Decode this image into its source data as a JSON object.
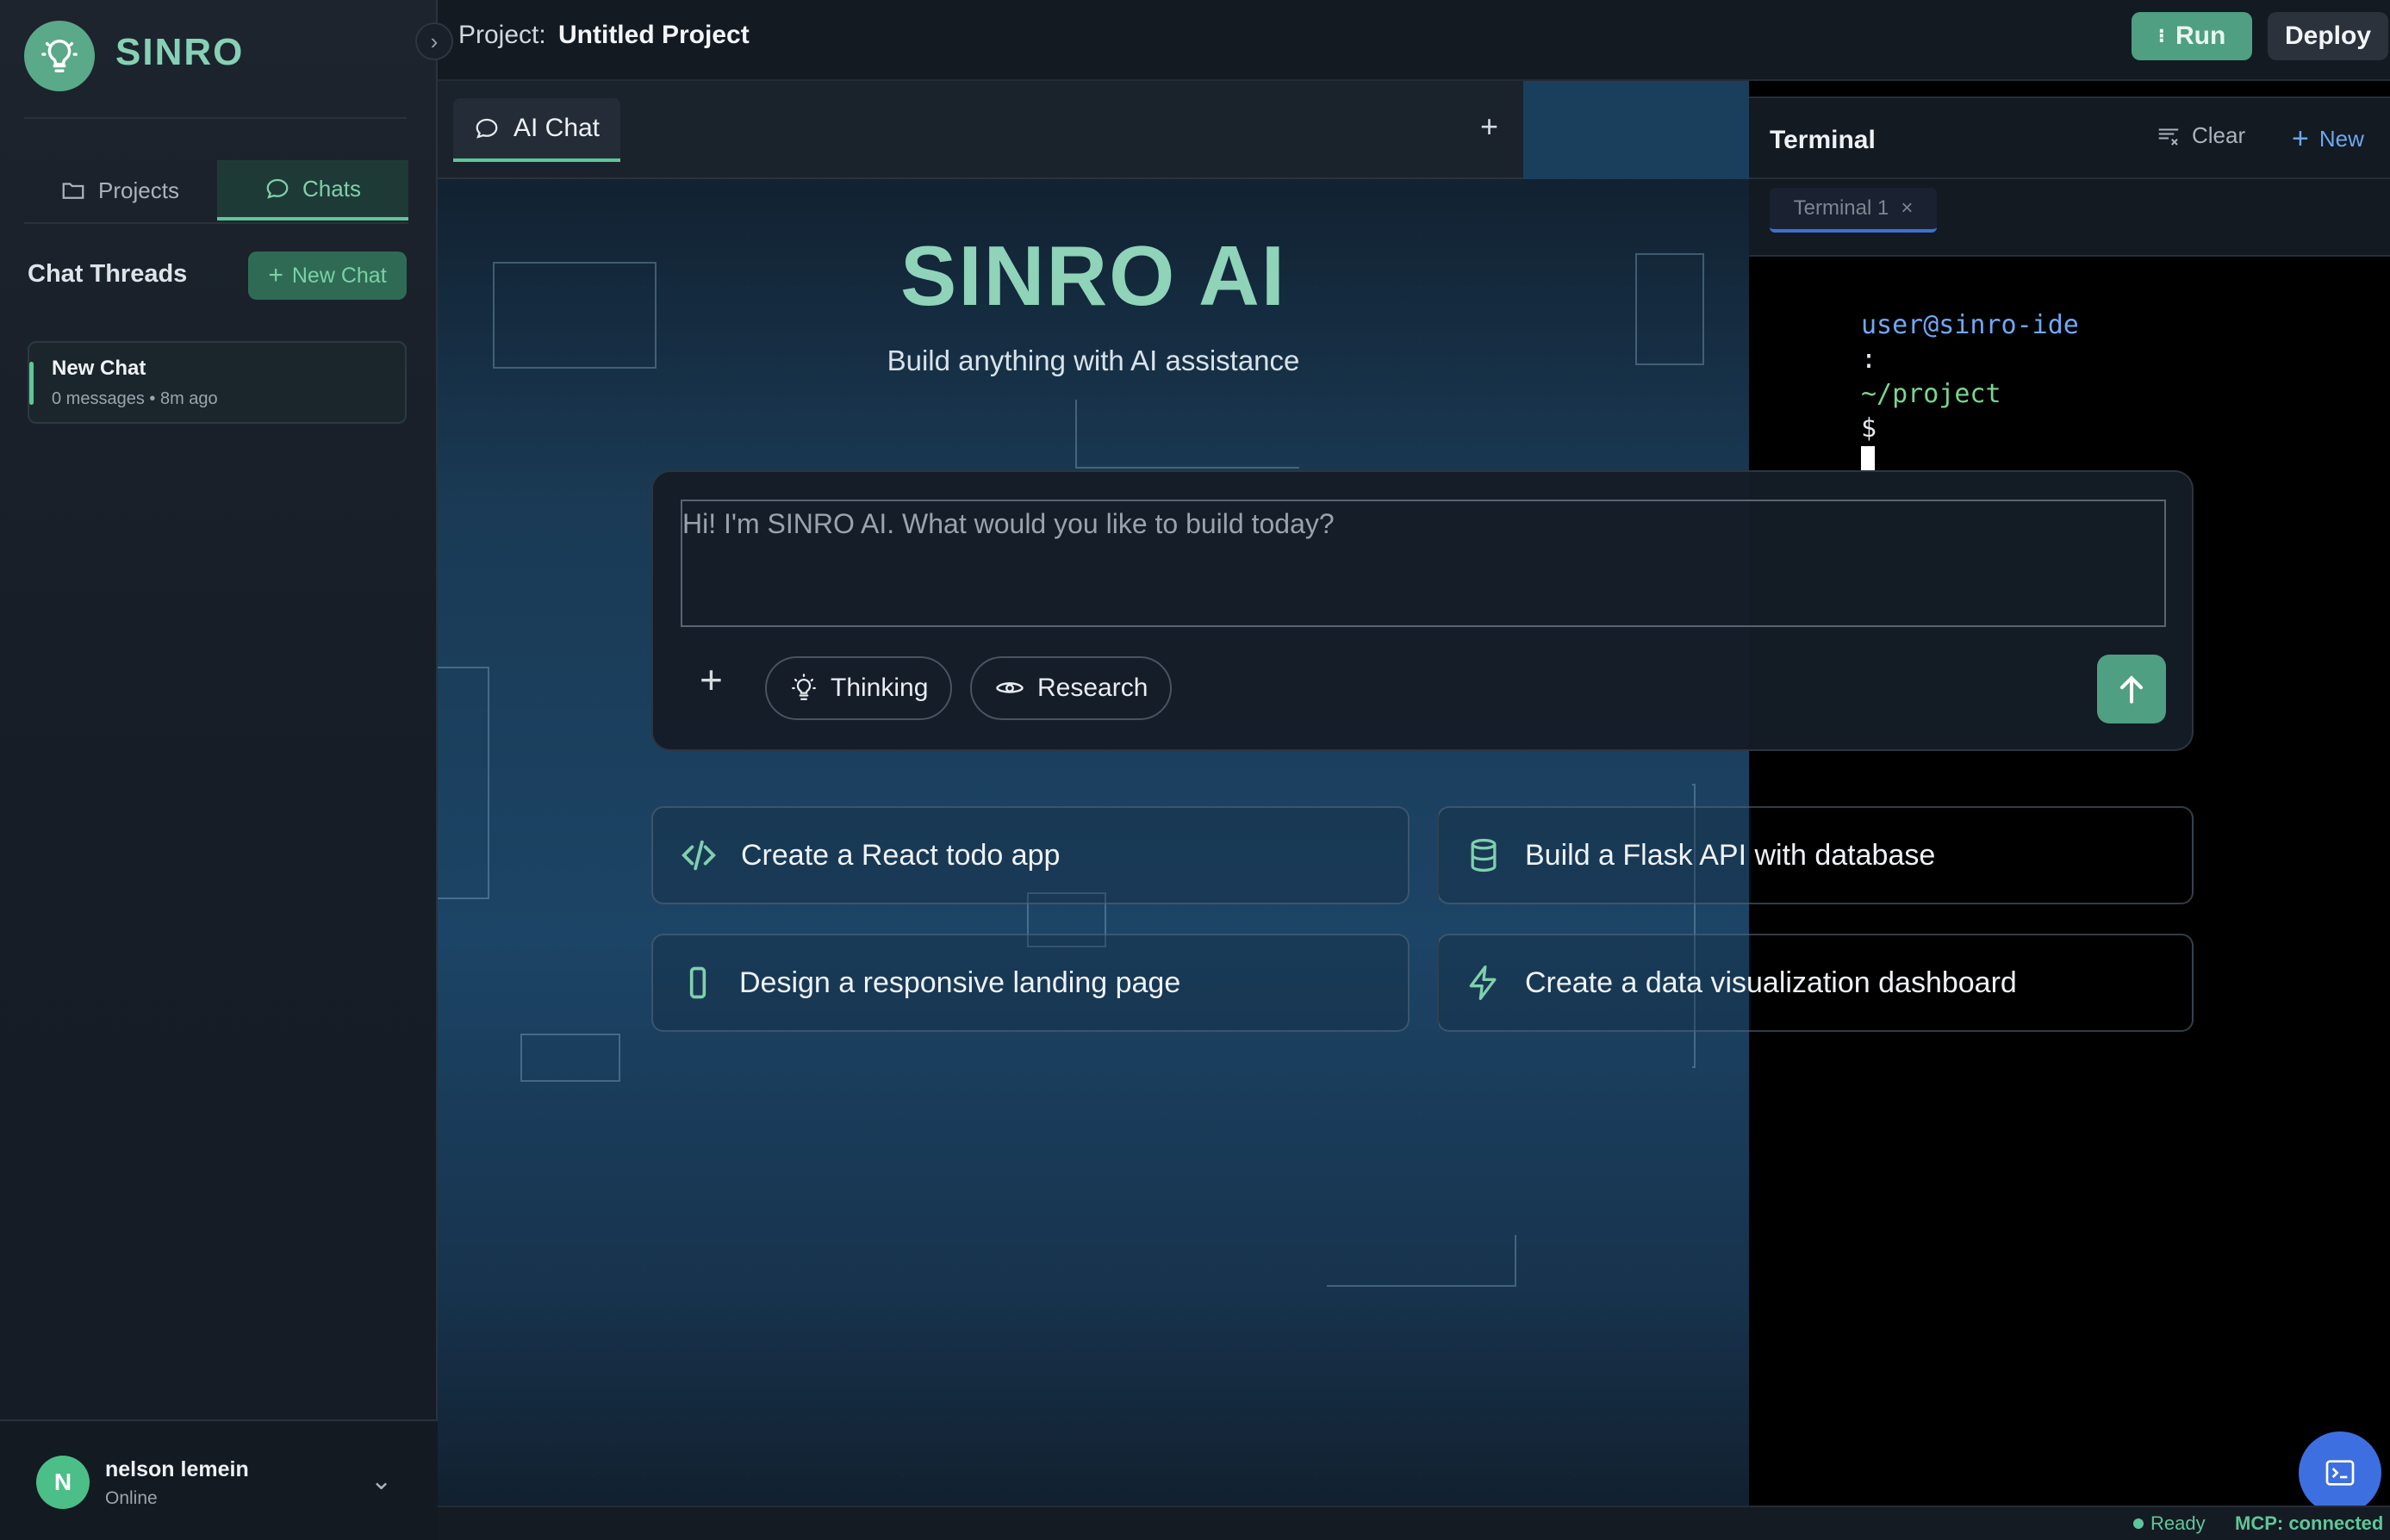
{
  "sidebar": {
    "brand": "SINRO",
    "tabs": [
      {
        "label": "Projects",
        "icon": "folder-icon",
        "active": false
      },
      {
        "label": "Chats",
        "icon": "chat-icon",
        "active": true
      }
    ],
    "threads_title": "Chat Threads",
    "new_chat_label": "New Chat",
    "threads": [
      {
        "title": "New Chat",
        "meta": "0 messages • 8m ago"
      }
    ],
    "user": {
      "initial": "N",
      "name": "nelson lemein",
      "status": "Online"
    }
  },
  "topbar": {
    "project_label": "Project:",
    "project_name": "Untitled Project",
    "run_label": "Run",
    "deploy_label": "Deploy"
  },
  "chat": {
    "tab_label": "AI Chat",
    "hero_title": "SINRO AI",
    "hero_subtitle": "Build anything with AI assistance",
    "input_placeholder": "Hi! I'm SINRO AI. What would you like to build today?",
    "chips": [
      {
        "label": "Thinking",
        "icon": "lightbulb-icon"
      },
      {
        "label": "Research",
        "icon": "eye-icon"
      }
    ],
    "suggestions": [
      {
        "label": "Create a React todo app",
        "icon": "code-icon"
      },
      {
        "label": "Build a Flask API with database",
        "icon": "database-icon"
      },
      {
        "label": "Design a responsive landing page",
        "icon": "mobile-icon"
      },
      {
        "label": "Create a data visualization dashboard",
        "icon": "lightning-icon"
      }
    ]
  },
  "terminal": {
    "title": "Terminal",
    "clear_label": "Clear",
    "new_label": "New",
    "tab_label": "Terminal 1",
    "prompt_user": "user@sinro-ide",
    "prompt_sep": ":",
    "prompt_path": "~/project",
    "prompt_symbol": "$"
  },
  "status": {
    "ready": "Ready",
    "mcp": "MCP: connected"
  },
  "colors": {
    "accent": "#5ec69a",
    "brand": "#86d1b5",
    "terminal_blue": "#3d6fe0"
  }
}
